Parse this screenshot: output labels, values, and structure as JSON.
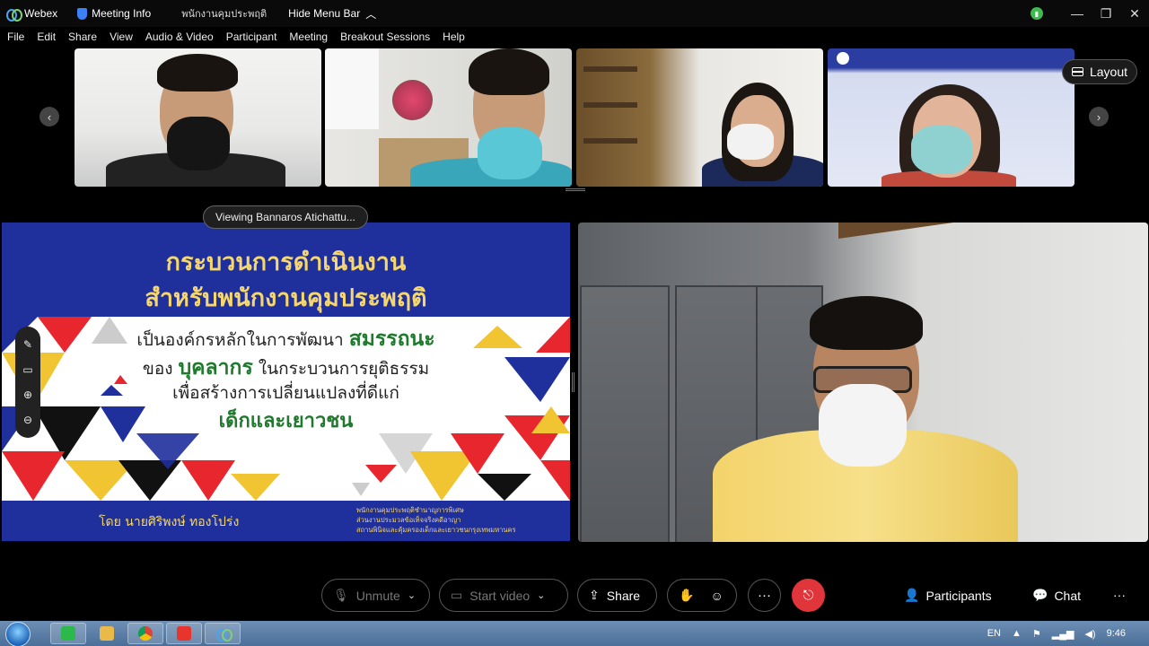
{
  "titlebar": {
    "app_name": "Webex",
    "meeting_info": "Meeting Info",
    "meeting_title": "พนักงานคุมประพฤติ",
    "hide_menu": "Hide Menu Bar"
  },
  "menu": [
    "File",
    "Edit",
    "Share",
    "View",
    "Audio & Video",
    "Participant",
    "Meeting",
    "Breakout Sessions",
    "Help"
  ],
  "layout_label": "Layout",
  "viewing_label": "Viewing Bannaros Atichattu...",
  "slide": {
    "title_line1": "กระบวนการดำเนินงาน",
    "title_line2": "สำหรับพนักงานคุมประพฤติ",
    "line1": "เป็นองค์กรหลักในการพัฒนา",
    "line1_em": "สมรรถนะ",
    "line2_pre": "ของ",
    "line2_em": "บุคลากร",
    "line2_post": "ในกระบวนการยุติธรรม",
    "line3": "เพื่อสร้างการเปลี่ยนแปลงที่ดีแก่",
    "line4": "เด็กและเยาวชน",
    "author": "โดย นายศิริพงษ์  ทองโปร่ง",
    "org_line1": "พนักงานคุมประพฤติชำนาญการพิเศษ",
    "org_line2": "ส่วนงานประมวลข้อเท็จจริงคดีอาญา",
    "org_line3": "สถานพินิจและคุ้มครองเด็กและเยาวชนกรุงเทพมหานคร"
  },
  "controls": {
    "unmute": "Unmute",
    "start_video": "Start video",
    "share": "Share",
    "participants": "Participants",
    "chat": "Chat",
    "more": "···"
  },
  "tray": {
    "language": "EN",
    "time": "9:46"
  },
  "colors": {
    "slide_blue": "#1f2f9c",
    "slide_gold": "#f5d76e",
    "end_red": "#e0353a"
  }
}
